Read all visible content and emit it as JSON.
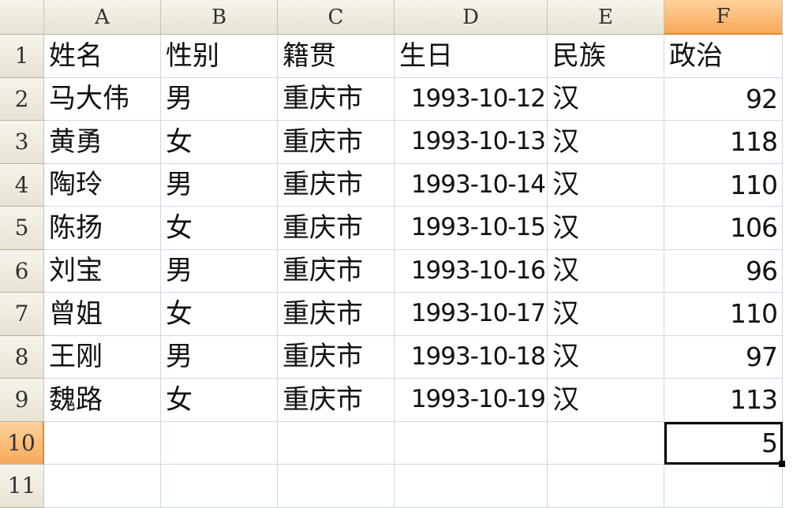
{
  "columns": [
    "A",
    "B",
    "C",
    "D",
    "E",
    "F"
  ],
  "row_numbers": [
    "1",
    "2",
    "3",
    "4",
    "5",
    "6",
    "7",
    "8",
    "9",
    "10",
    "11"
  ],
  "active_column": "F",
  "active_row": "10",
  "header_row": [
    "姓名",
    "性别",
    "籍贯",
    "生日",
    "民族",
    "政治"
  ],
  "rows": [
    [
      "马大伟",
      "男",
      "重庆市",
      "1993-10-12",
      "汉",
      "92"
    ],
    [
      "黄勇",
      "女",
      "重庆市",
      "1993-10-13",
      "汉",
      "118"
    ],
    [
      "陶玲",
      "男",
      "重庆市",
      "1993-10-14",
      "汉",
      "110"
    ],
    [
      "陈扬",
      "女",
      "重庆市",
      "1993-10-15",
      "汉",
      "106"
    ],
    [
      "刘宝",
      "男",
      "重庆市",
      "1993-10-16",
      "汉",
      "96"
    ],
    [
      "曾姐",
      "女",
      "重庆市",
      "1993-10-17",
      "汉",
      "110"
    ],
    [
      "王刚",
      "男",
      "重庆市",
      "1993-10-18",
      "汉",
      "97"
    ],
    [
      "魏路",
      "女",
      "重庆市",
      "1993-10-19",
      "汉",
      "113"
    ]
  ],
  "row10": [
    "",
    "",
    "",
    "",
    "",
    "5"
  ],
  "colors": {
    "header_bg": "#ece9d8",
    "active_header": "#f7a95a",
    "gridline": "#d0d7e5"
  }
}
